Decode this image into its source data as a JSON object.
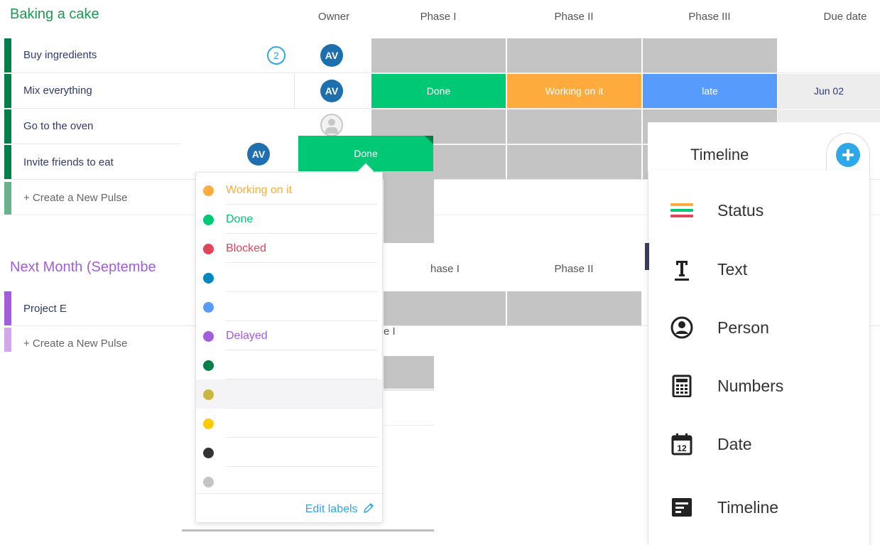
{
  "board": {
    "group1": {
      "title": "Baking a cake",
      "title_color": "#1b9a4f",
      "bar_color": "#037f4c",
      "columns": {
        "owner": "Owner",
        "phase1": "Phase I",
        "phase2": "Phase II",
        "phase3": "Phase III",
        "due": "Due date"
      },
      "rows": [
        {
          "name": "Buy ingredients",
          "badge": "2",
          "owner": "AV"
        },
        {
          "name": "Mix everything",
          "owner": "AV",
          "phase1": "Done",
          "phase2": "Working on it",
          "phase3": "late",
          "due": "Jun 02"
        },
        {
          "name": "Go to the oven"
        },
        {
          "name": "Invite friends to eat"
        }
      ],
      "create_label": "+ Create a New Pulse"
    },
    "group2": {
      "title": "Next Month (Septembe",
      "title_color": "#a25ddc",
      "bar_color": "#a25ddc",
      "columns": {
        "phase1_partial": "hase I",
        "phase2": "Phase II"
      },
      "rows": [
        {
          "name": "Project E"
        }
      ],
      "create_label": "+ Create a New Pulse",
      "hidden_text_partial": "e I"
    }
  },
  "status_popup": {
    "owner": "AV",
    "current": "Done",
    "current_color": "#00c875",
    "labels": [
      {
        "text": "Working on it",
        "color": "#fdab3d"
      },
      {
        "text": "Done",
        "color": "#00c875"
      },
      {
        "text": "Blocked",
        "color": "#e2445c"
      },
      {
        "text": "",
        "color": "#0086c0"
      },
      {
        "text": "",
        "color": "#579bfc"
      },
      {
        "text": "Delayed",
        "color": "#a25ddc"
      },
      {
        "text": "",
        "color": "#037f4c"
      },
      {
        "text": "",
        "color": "#cab641"
      },
      {
        "text": "",
        "color": "#ffcb00"
      },
      {
        "text": "",
        "color": "#333333"
      },
      {
        "text": "",
        "color": "#c4c4c4"
      }
    ],
    "edit_labels": "Edit labels"
  },
  "column_types": {
    "header": "Timeline",
    "items": [
      {
        "label": "Status",
        "icon": "status-icon"
      },
      {
        "label": "Text",
        "icon": "text-icon"
      },
      {
        "label": "Person",
        "icon": "person-icon"
      },
      {
        "label": "Numbers",
        "icon": "numbers-icon"
      },
      {
        "label": "Date",
        "icon": "date-icon",
        "icon_text": "12"
      },
      {
        "label": "Timeline",
        "icon": "timeline-icon"
      }
    ]
  },
  "colors": {
    "done": "#00c875",
    "working": "#fdab3d",
    "late": "#579bfc",
    "empty_cell": "#c4c4c4",
    "accent": "#2ea8e8"
  }
}
